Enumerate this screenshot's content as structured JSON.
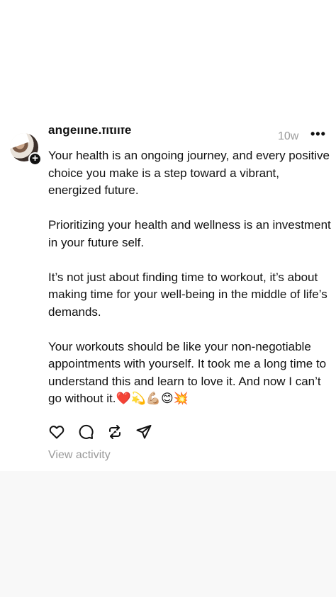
{
  "post": {
    "username": "angeline.fitlife",
    "timestamp": "10w",
    "more_label": "•••",
    "paragraphs": [
      "Your health is an ongoing journey, and every positive choice you make is a step toward a vibrant, energized future.",
      "Prioritizing your health and wellness is an investment in your future self.",
      "It’s not just about finding time to workout, it’s about making time for your well-being in the middle of life’s demands.",
      "Your workouts should be like your non-negotiable appointments with yourself. It took me a long time to understand this and learn to love it. And now I can’t go without it."
    ],
    "emojis": "❤️💫💪🏼😊💥",
    "actions": {
      "like": "heart-icon",
      "comment": "comment-icon",
      "repost": "repost-icon",
      "share": "share-icon"
    },
    "view_activity": "View activity"
  },
  "colors": {
    "text": "#111111",
    "muted": "#9a9a9a",
    "background": "#ffffff",
    "footer_band": "#f8f8f8"
  }
}
